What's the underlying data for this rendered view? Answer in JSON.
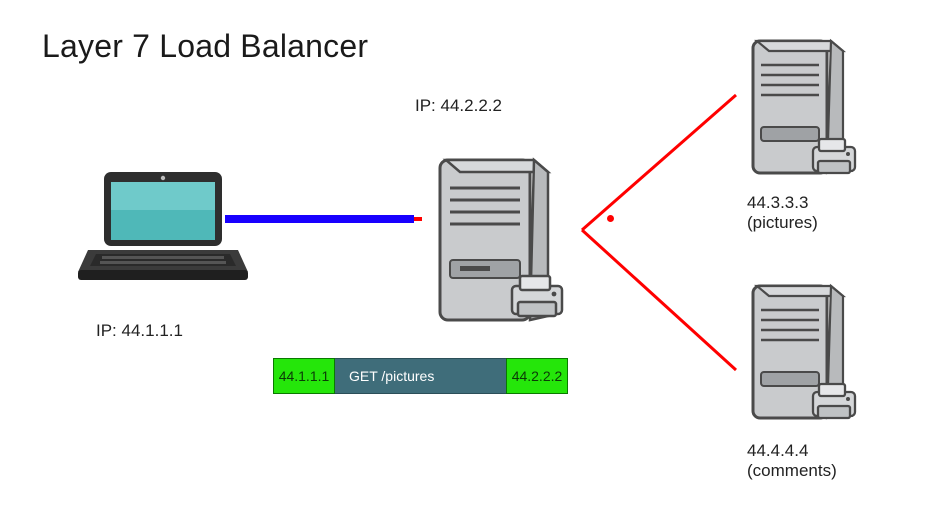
{
  "title": "Layer 7 Load Balancer",
  "client": {
    "ip_label": "IP: 44.1.1.1"
  },
  "load_balancer": {
    "ip_label": "IP: 44.2.2.2"
  },
  "backends": {
    "pictures": {
      "ip": "44.3.3.3",
      "role": "(pictures)"
    },
    "comments": {
      "ip": "44.4.4.4",
      "role": "(comments)"
    }
  },
  "packet": {
    "src_ip": "44.1.1.1",
    "request": "GET /pictures",
    "dst_ip": "44.2.2.2"
  },
  "colors": {
    "client_link": "#1800ff",
    "branch": "#ff0000",
    "packet_ip_bg": "#25e60a",
    "packet_req_bg": "#3f6d7a"
  }
}
